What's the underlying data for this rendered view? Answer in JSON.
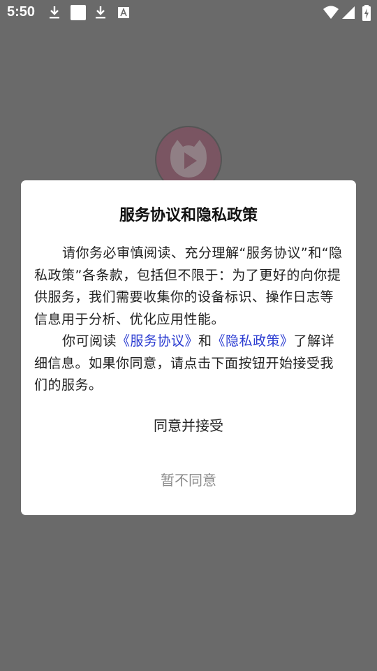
{
  "status_bar": {
    "time": "5:50",
    "icons": [
      "download-icon",
      "square-icon",
      "download-icon",
      "font-icon",
      "wifi-icon",
      "signal-icon",
      "battery-charging-icon"
    ]
  },
  "dialog": {
    "title": "服务协议和隐私政策",
    "paragraph1": "请你务必审慎阅读、充分理解“服务协议”和“隐私政策”各条款，包括但不限于：为了更好的向你提供服务，我们需要收集你的设备标识、操作日志等信息用于分析、优化应用性能。",
    "p2_prefix": "你可阅读",
    "link_service": "《服务协议》",
    "p2_and": "和",
    "link_privacy": "《隐私政策》",
    "p2_suffix": "了解详细信息。如果你同意，请点击下面按钮开始接受我们的服务。",
    "agree_button": "同意并接受",
    "decline_button": "暂不同意"
  },
  "colors": {
    "overlay": "#6a6a6a",
    "link": "#2a3bd1",
    "logo_pink": "#7a5562"
  }
}
